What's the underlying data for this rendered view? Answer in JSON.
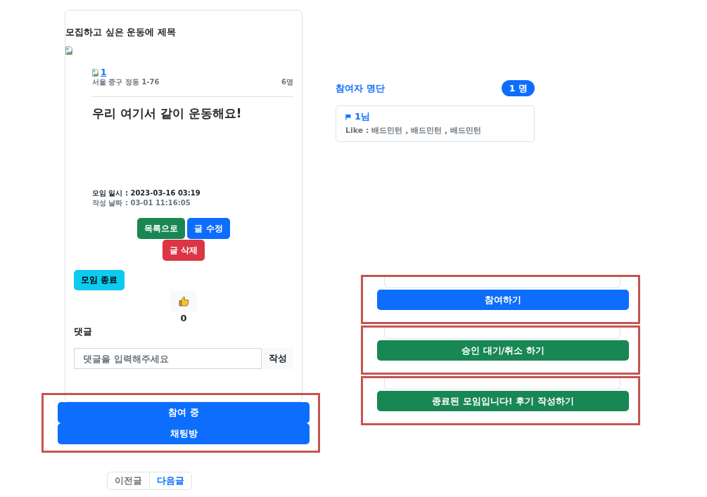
{
  "post": {
    "title": "모집하고 싶은 운동에 제목",
    "author": "1",
    "location": "서울 중구 정동 1-76",
    "capacity": "6명",
    "heading": "우리 여기서 같이 운동해요!",
    "meeting_time": "모임 일시 : 2023-03-16 03:19",
    "written_date": "작성 날짜 : 03-01 11:16:05",
    "actions": [
      {
        "label": "목록으로",
        "kind": "success"
      },
      {
        "label": "글 수정",
        "kind": "primary"
      },
      {
        "label": "글 삭제",
        "kind": "danger"
      }
    ],
    "close_button": {
      "label": "모임 종료",
      "kind": "info"
    },
    "like_count": "0",
    "comments": {
      "title": "댓글",
      "placeholder": "댓글을 입력해주세요",
      "submit_button": "작성"
    }
  },
  "join_buttons": [
    {
      "label": "참여 중",
      "kind": "primary"
    },
    {
      "label": "채팅방",
      "kind": "primary"
    }
  ],
  "pager": [
    {
      "label": "이전글",
      "disabled": true
    },
    {
      "label": "다음글",
      "disabled": false
    }
  ],
  "participants": {
    "title": "참여자 명단",
    "count": "1 명",
    "members": [
      {
        "name": "1님",
        "likes": "Like : 배드민턴 , 배드민턴 , 배드민턴"
      }
    ]
  },
  "button_states": [
    {
      "label": "참여하기",
      "kind": "primary"
    },
    {
      "label": "승인 대기/취소 하기",
      "kind": "success"
    },
    {
      "label": "종료된 모임입니다! 후기 작성하기",
      "kind": "success"
    }
  ]
}
